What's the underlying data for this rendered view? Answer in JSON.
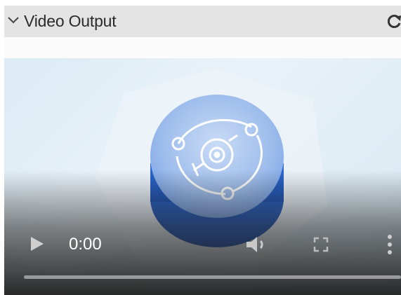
{
  "panel": {
    "title": "Video Output",
    "icons": {
      "collapse": "chevron-down-icon",
      "refresh": "refresh-icon"
    }
  },
  "player": {
    "current_time": "0:00",
    "progress": 0,
    "icons": {
      "play": "play-icon",
      "volume": "volume-icon",
      "fullscreen": "fullscreen-icon",
      "more": "more-vertical-icon"
    }
  },
  "colors": {
    "header_bg": "#e4e4e4",
    "logo_blue": "#2f6fd6",
    "logo_light": "#a9c6ef"
  }
}
